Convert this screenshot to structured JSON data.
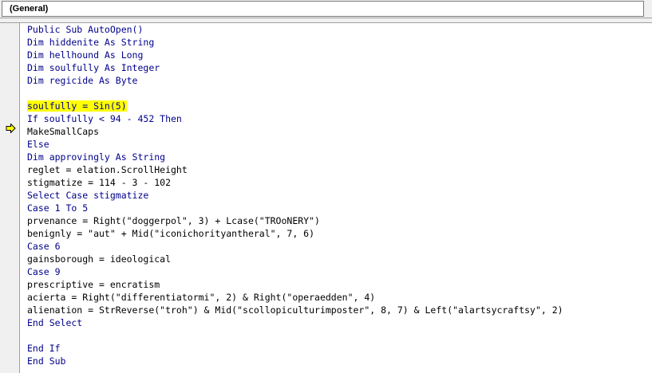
{
  "procedure_dropdown": {
    "value": "(General)"
  },
  "current_line_marker": {
    "icon": "execution-arrow-icon",
    "color": "#ffff00"
  },
  "code_lines": [
    {
      "text": "Public Sub AutoOpen()",
      "kind": "keyword"
    },
    {
      "text": "Dim hiddenite As String",
      "kind": "keyword"
    },
    {
      "text": "Dim hellhound As Long",
      "kind": "keyword"
    },
    {
      "text": "Dim soulfully As Integer",
      "kind": "keyword"
    },
    {
      "text": "Dim regicide As Byte",
      "kind": "keyword"
    },
    {
      "text": "",
      "kind": "plain"
    },
    {
      "text": "soulfully = Sin(5)",
      "kind": "highlight"
    },
    {
      "text": "If soulfully < 94 - 452 Then",
      "kind": "keyword"
    },
    {
      "text": "MakeSmallCaps",
      "kind": "plain"
    },
    {
      "text": "Else",
      "kind": "keyword"
    },
    {
      "text": "Dim approvingly As String",
      "kind": "keyword"
    },
    {
      "text": "reglet = elation.ScrollHeight",
      "kind": "plain"
    },
    {
      "text": "stigmatize = 114 - 3 - 102",
      "kind": "plain"
    },
    {
      "text": "Select Case stigmatize",
      "kind": "keyword"
    },
    {
      "text": "Case 1 To 5",
      "kind": "keyword"
    },
    {
      "text": "prvenance = Right(\"doggerpol\", 3) + Lcase(\"TROoNERY\")",
      "kind": "plain"
    },
    {
      "text": "benignly = \"aut\" + Mid(\"iconichorityantheral\", 7, 6)",
      "kind": "plain"
    },
    {
      "text": "Case 6",
      "kind": "keyword"
    },
    {
      "text": "gainsborough = ideological",
      "kind": "plain"
    },
    {
      "text": "Case 9",
      "kind": "keyword"
    },
    {
      "text": "prescriptive = encratism",
      "kind": "plain"
    },
    {
      "text": "acierta = Right(\"differentiatormi\", 2) & Right(\"operaedden\", 4)",
      "kind": "plain"
    },
    {
      "text": "alienation = StrReverse(\"troh\") & Mid(\"scollopiculturimposter\", 8, 7) & Left(\"alartsycraftsy\", 2)",
      "kind": "plain"
    },
    {
      "text": "End Select",
      "kind": "keyword"
    },
    {
      "text": "",
      "kind": "plain"
    },
    {
      "text": "End If",
      "kind": "keyword"
    },
    {
      "text": "End Sub",
      "kind": "keyword"
    }
  ]
}
